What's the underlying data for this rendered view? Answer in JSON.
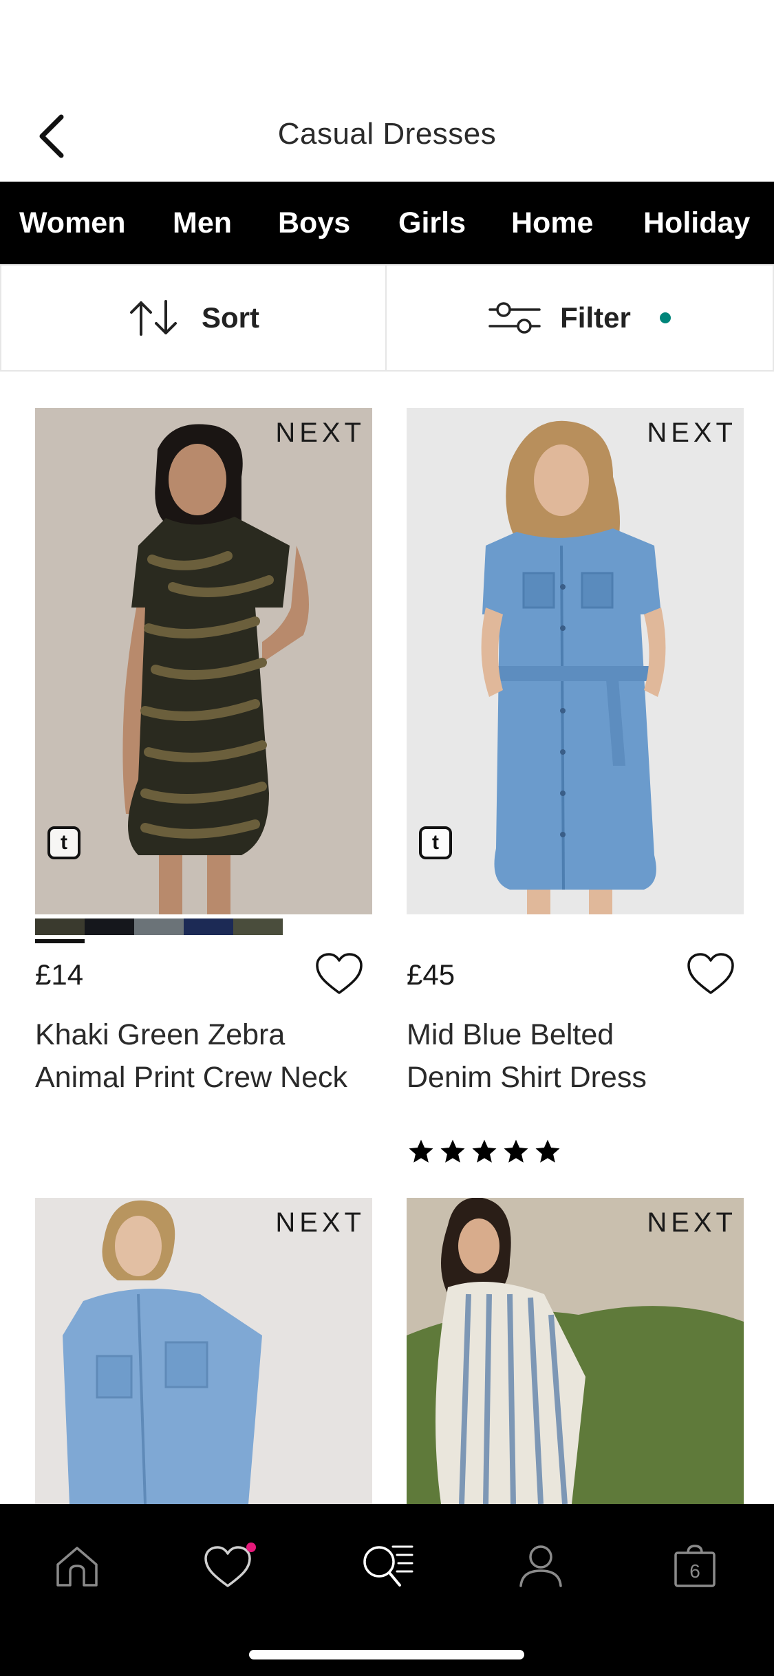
{
  "header": {
    "title": "Casual Dresses",
    "back_icon": "chevron-left-icon"
  },
  "categories": [
    "Women",
    "Men",
    "Boys",
    "Girls",
    "Home",
    "Holiday"
  ],
  "controls": {
    "sort_label": "Sort",
    "filter_label": "Filter",
    "filter_active_color": "#00857a"
  },
  "products": [
    {
      "brand": "NEXT",
      "price": "£14",
      "name_line1": "Khaki Green Zebra",
      "name_line2": "Animal Print Crew Neck",
      "swatch_colors": [
        "#3a3a2e",
        "#15171c",
        "#6b7378",
        "#1c2a55",
        "#4a4d3c"
      ],
      "has_rating": false
    },
    {
      "brand": "NEXT",
      "price": "£45",
      "name_line1": "Mid Blue Belted",
      "name_line2": "Denim Shirt Dress",
      "rating": 5,
      "has_rating": true
    },
    {
      "brand": "NEXT"
    },
    {
      "brand": "NEXT"
    }
  ],
  "tabbar": {
    "items": [
      "home-icon",
      "wishlist-icon",
      "search-icon",
      "account-icon",
      "bag-icon"
    ],
    "bag_count": "6",
    "wishlist_badge_color": "#e5197a"
  }
}
